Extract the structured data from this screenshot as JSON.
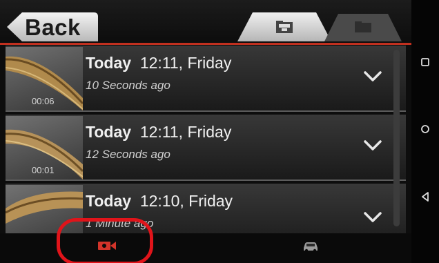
{
  "header": {
    "back_label": "Back",
    "tabs": [
      {
        "name": "folder-open-icon",
        "active": true
      },
      {
        "name": "folder-icon",
        "active": false
      }
    ],
    "accent_color": "#c1301f"
  },
  "recordings": [
    {
      "day": "Today",
      "time": "12:11, Friday",
      "ago": "10 Seconds ago",
      "duration": "00:06"
    },
    {
      "day": "Today",
      "time": "12:11, Friday",
      "ago": "12 Seconds ago",
      "duration": "00:01"
    },
    {
      "day": "Today",
      "time": "12:10, Friday",
      "ago": "1 Minute ago",
      "duration": ""
    }
  ],
  "bottom_bar": {
    "items": [
      {
        "name": "video-camera-icon",
        "active": true,
        "color": "#d2342a"
      },
      {
        "name": "car-icon",
        "active": false,
        "color": "#9a9a9a"
      }
    ]
  },
  "system_nav": [
    "square-icon",
    "circle-icon",
    "triangle-back-icon"
  ]
}
